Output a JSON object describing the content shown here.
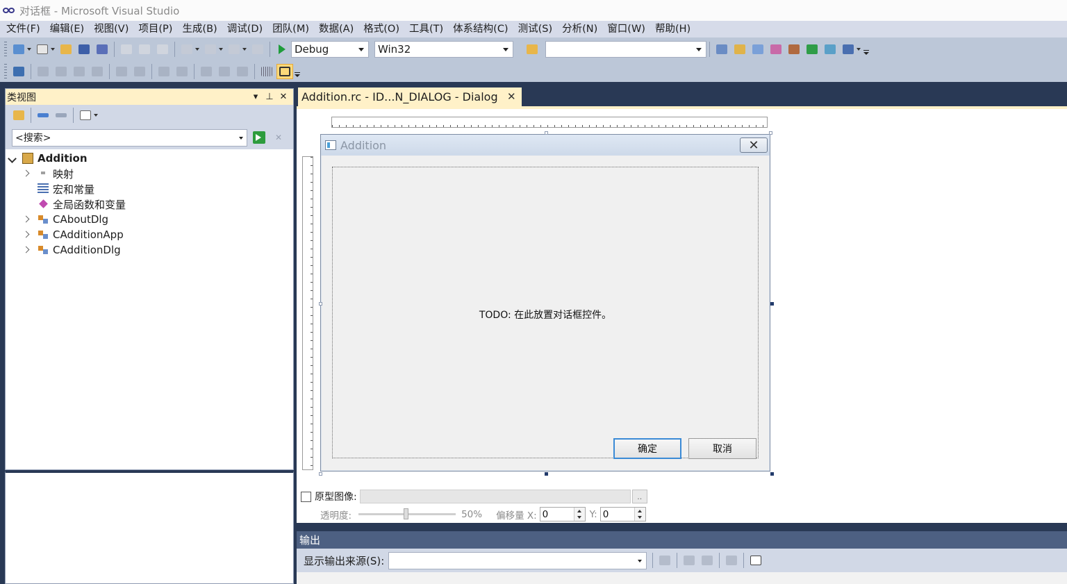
{
  "window": {
    "title": "对话框 - Microsoft Visual Studio"
  },
  "menu": [
    "文件(F)",
    "编辑(E)",
    "视图(V)",
    "项目(P)",
    "生成(B)",
    "调试(D)",
    "团队(M)",
    "数据(A)",
    "格式(O)",
    "工具(T)",
    "体系结构(C)",
    "测试(S)",
    "分析(N)",
    "窗口(W)",
    "帮助(H)"
  ],
  "toolbar": {
    "config": "Debug",
    "platform": "Win32",
    "find_value": ""
  },
  "class_view": {
    "title": "类视图",
    "search_placeholder": "<搜索>",
    "root": "Addition",
    "items": [
      "映射",
      "宏和常量",
      "全局函数和变量",
      "CAboutDlg",
      "CAdditionApp",
      "CAdditionDlg"
    ]
  },
  "editor": {
    "tab_label": "Addition.rc - ID...N_DIALOG - Dialog",
    "dialog": {
      "title": "Addition",
      "todo_text": "TODO: 在此放置对话框控件。",
      "ok_label": "确定",
      "cancel_label": "取消"
    },
    "prototype": {
      "label": "原型图像:",
      "browse": "..",
      "opacity_label": "透明度:",
      "opacity_value": "50%",
      "offset_x_label": "偏移量 X:",
      "offset_x": "0",
      "offset_y_label": "Y:",
      "offset_y": "0"
    }
  },
  "output": {
    "title": "输出",
    "source_label": "显示输出来源(S):",
    "source_value": ""
  },
  "colors": {
    "chrome_dark": "#293955",
    "tab_active": "#fff1c8",
    "menu_bg": "#d6dbe9",
    "toolbar_bg": "#bcc7d8"
  }
}
